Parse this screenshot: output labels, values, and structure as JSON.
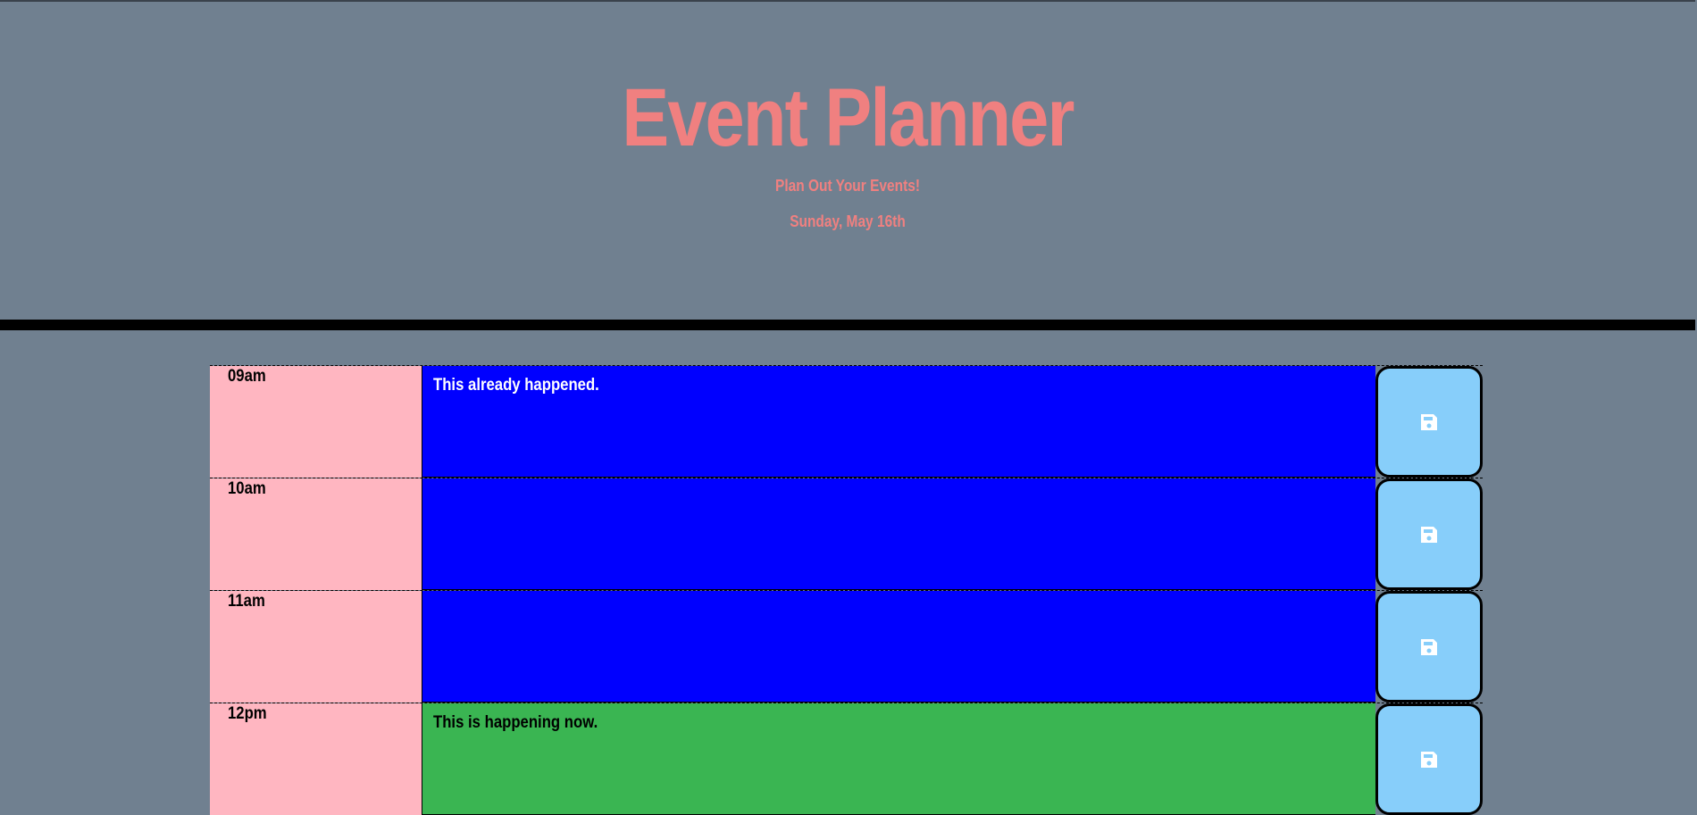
{
  "header": {
    "title": "Event Planner",
    "subtitle": "Plan Out Your Events!",
    "current_date": "Sunday, May 16th"
  },
  "schedule": {
    "rows": [
      {
        "hour": "09am",
        "text": "This already happened.",
        "status": "past",
        "save_icon": "save-icon"
      },
      {
        "hour": "10am",
        "text": "",
        "status": "past",
        "save_icon": "save-icon"
      },
      {
        "hour": "11am",
        "text": "",
        "status": "past",
        "save_icon": "save-icon"
      },
      {
        "hour": "12pm",
        "text": "This is happening now.",
        "status": "present",
        "save_icon": "save-icon"
      }
    ]
  },
  "colors": {
    "page_background": "#708090",
    "title": "#f08080",
    "hour_column": "#ffb6c1",
    "past": "#0000ff",
    "present": "#3ab552",
    "save_button": "#87cefa",
    "header_border": "#000000"
  }
}
